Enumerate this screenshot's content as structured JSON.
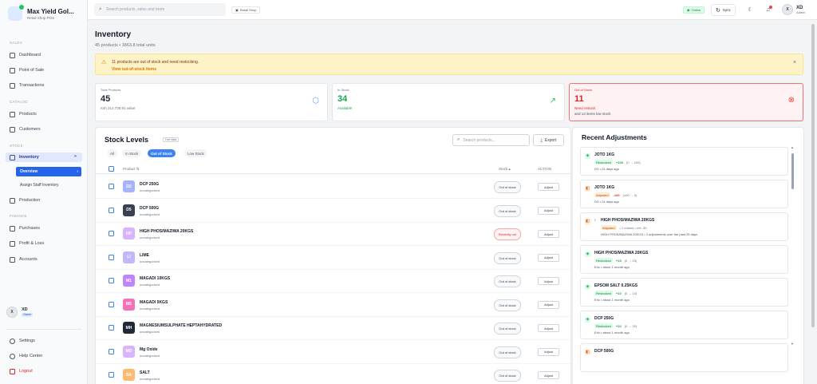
{
  "app": {
    "name": "Max Yield Gol...",
    "subtitle": "Retail Shop POS"
  },
  "sidebar": {
    "sections": [
      {
        "title": "SALES",
        "items": [
          {
            "label": "Dashboard",
            "icon": "dashboard-icon"
          },
          {
            "label": "Point of Sale",
            "icon": "cart-icon"
          },
          {
            "label": "Transactions",
            "icon": "receipt-icon"
          }
        ]
      },
      {
        "title": "CATALOG",
        "items": [
          {
            "label": "Products",
            "icon": "box-icon"
          },
          {
            "label": "Customers",
            "icon": "users-icon"
          }
        ]
      },
      {
        "title": "STOCK",
        "items": [
          {
            "label": "Inventory",
            "icon": "warehouse-icon"
          }
        ]
      },
      {
        "title": "FINANCE",
        "items": [
          {
            "label": "Purchases",
            "icon": "truck-icon"
          },
          {
            "label": "Profit & Loss",
            "icon": "trend-icon"
          },
          {
            "label": "Accounts",
            "icon": "accounts-icon"
          }
        ]
      }
    ],
    "inventory_sub": [
      {
        "label": "Overview"
      },
      {
        "label": "Assign Staff Inventory"
      }
    ],
    "production": {
      "label": "Production"
    },
    "user": {
      "initial": "X",
      "name": "XD",
      "role": "Owner"
    },
    "footer": [
      {
        "label": "Settings"
      },
      {
        "label": "Help Center"
      },
      {
        "label": "Logout"
      }
    ]
  },
  "topbar": {
    "search_placeholder": "Search products, sales and more",
    "shop_label": "Retail Shop",
    "online_label": "Online",
    "sync_label": "Sync",
    "user_initial": "X",
    "user_name": "XD",
    "user_role": "Admin"
  },
  "page": {
    "title": "Inventory",
    "subtitle": "45 products • 1863.8 total units"
  },
  "alert": {
    "message": "11 products are out of stock and need restocking.",
    "link": "View out-of-stock items"
  },
  "stats": [
    {
      "label": "Total Products",
      "value": "45",
      "note": "Ksh 212,735.91 value",
      "icon": "cube-icon"
    },
    {
      "label": "In Stock",
      "value": "34",
      "note": "Available",
      "icon": "trending-up-icon"
    },
    {
      "label": "Out of Stock",
      "value": "11",
      "note": "Need restock",
      "note2": "and 13 items low stock",
      "icon": "x-circle-icon"
    }
  ],
  "stock": {
    "title": "Stock Levels",
    "badge": "Live data",
    "filters": [
      "All",
      "In Stock",
      "Out of Stock",
      "Low Stock"
    ],
    "search_placeholder": "Search products...",
    "export_label": "Export",
    "columns": {
      "product": "Product",
      "stock": "Stock",
      "action": "ACTION"
    },
    "rows": [
      {
        "initials": "D2",
        "name": "DCP 250G",
        "category": "uncategorized",
        "status": "Out of stock",
        "color": "#a5b4fc",
        "recent": false
      },
      {
        "initials": "D5",
        "name": "DCP 500G",
        "category": "uncategorized",
        "status": "Out of stock",
        "color": "#374151",
        "recent": false
      },
      {
        "initials": "HP",
        "name": "HIGH PHOS/MAZIWA 20KGS",
        "category": "uncategorized",
        "status": "Recently out",
        "color": "#d8b4fe",
        "recent": true
      },
      {
        "initials": "LI",
        "name": "LIME",
        "category": "uncategorized",
        "status": "Out of stock",
        "color": "#c4b5fd",
        "recent": false
      },
      {
        "initials": "M1",
        "name": "MAGADI 10KGS",
        "category": "uncategorized",
        "status": "Out of stock",
        "color": "#c084fc",
        "recent": false
      },
      {
        "initials": "M5",
        "name": "MAGADI 5KGS",
        "category": "uncategorized",
        "status": "Out of stock",
        "color": "#f472b6",
        "recent": false
      },
      {
        "initials": "MH",
        "name": "MAGNESIUMSULPHATE HEPTAHYDRATED",
        "category": "uncategorized",
        "status": "Out of stock",
        "color": "#1f2937",
        "recent": false
      },
      {
        "initials": "MO",
        "name": "Mg Oxide",
        "category": "uncategorized",
        "status": "Out of stock",
        "color": "#d8b4fe",
        "recent": false
      },
      {
        "initials": "SA",
        "name": "SALT",
        "category": "uncategorized",
        "status": "Out of stock",
        "color": "#fdba74",
        "recent": false
      }
    ],
    "adjust_label": "Adjust"
  },
  "adjustments": {
    "title": "Recent Adjustments",
    "items": [
      {
        "name": "JOTO 1KG",
        "tag": "Restocked",
        "kind": "g",
        "delta": "+100",
        "range": "(0 → 100)",
        "meta": "DX • 24 days ago"
      },
      {
        "name": "JOTO 1KG",
        "tag": "Adjusted",
        "kind": "o",
        "delta": "-100",
        "range": "(100 → 0)",
        "meta": "DX • 24 days ago"
      },
      {
        "name": "HIGH PHOS/MAZIWA 20KGS",
        "tag": "Adjusted",
        "kind": "o",
        "delta": "• 2 entries • net -30",
        "range": "",
        "meta": "HIGH PHOS/MAZIWA 20KGS • 2 adjustments over the past 25 days"
      },
      {
        "name": "HIGH PHOS/MAZIWA 20KGS",
        "tag": "Restocked",
        "kind": "g",
        "delta": "+15",
        "range": "(0 → 15)",
        "meta": "Eric • about 1 month ago"
      },
      {
        "name": "EPSOM SALT 0.25KGS",
        "tag": "Restocked",
        "kind": "g",
        "delta": "+10",
        "range": "(0 → 10)",
        "meta": "Eric • about 1 month ago"
      },
      {
        "name": "DCP 250G",
        "tag": "Restocked",
        "kind": "g",
        "delta": "+20",
        "range": "(0 → 20)",
        "meta": "Eric • about 1 month ago"
      },
      {
        "name": "DCP 500G",
        "tag": "",
        "kind": "o",
        "delta": "",
        "range": "",
        "meta": ""
      }
    ]
  },
  "colors": {
    "accent": "#2563eb",
    "danger": "#dc2626",
    "success": "#16a34a",
    "warning": "#d97706"
  }
}
